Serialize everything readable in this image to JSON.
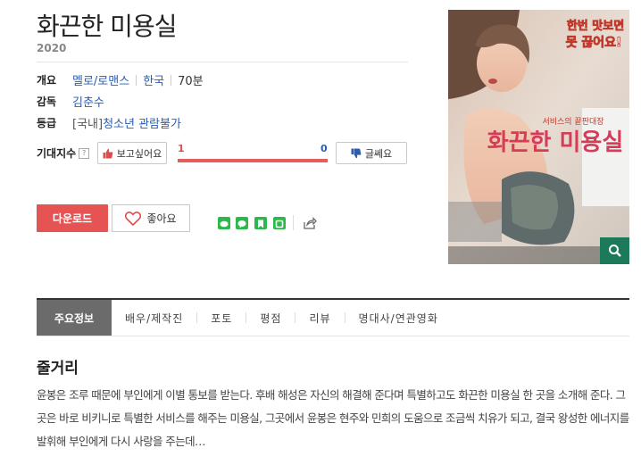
{
  "movie": {
    "title": "화끈한 미용실",
    "year": "2020"
  },
  "info": {
    "overview_label": "개요",
    "genre": "멜로/로맨스",
    "country": "한국",
    "runtime": "70분",
    "director_label": "감독",
    "director": "김춘수",
    "rating_label": "등급",
    "rating_prefix": "[국내]",
    "rating": "청소년 관람불가"
  },
  "expectation": {
    "label": "기대지수",
    "help": "?",
    "want_label": "보고싶어요",
    "meh_label": "글쎄요",
    "want_count": "1",
    "meh_count": "0",
    "want_ratio": 1.0
  },
  "actions": {
    "download_label": "다운로드",
    "like_label": "좋아요"
  },
  "colors": {
    "accent_red": "#e55353",
    "link_blue": "#2a5db0",
    "zoom_green": "#1c7a5a"
  },
  "share_icons": [
    "line-icon",
    "kakaotalk-icon",
    "bookmark-icon",
    "band-icon",
    "share-icon"
  ],
  "poster": {
    "tagline": "한번 맛보면 못 끊어요!",
    "subtitle": "서비스의 끝판대장",
    "title": "화끈한 미용실"
  },
  "tabs": [
    "주요정보",
    "배우/제작진",
    "포토",
    "평점",
    "리뷰",
    "명대사/연관영화"
  ],
  "plot": {
    "heading": "줄거리",
    "text": "윤봉은 조루 때문에 부인에게 이별 통보를 받는다. 후배 해성은 자신의 해결해 준다며 특별하고도 화끈한 미용실 한 곳을 소개해 준다. 그곳은 바로 비키니로 특별한 서비스를 해주는 미용실, 그곳에서 윤봉은 현주와 민희의 도움으로 조금씩 치유가 되고, 결국 왕성한 에너지를 발휘해 부인에게 다시 사랑을 주는데…"
  }
}
